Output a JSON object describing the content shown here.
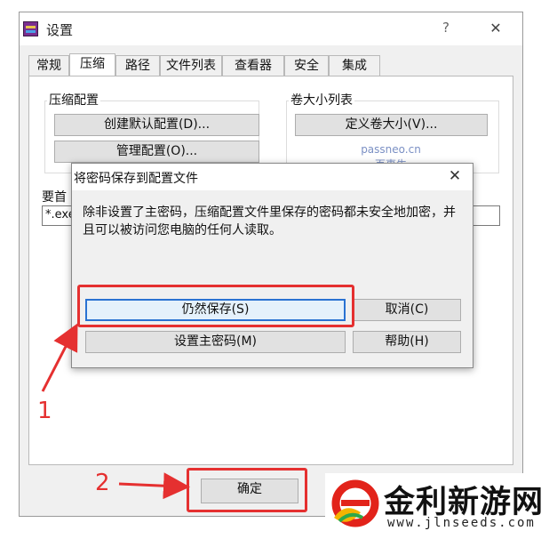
{
  "window": {
    "title": "设置",
    "help_glyph": "?",
    "close_glyph": "✕"
  },
  "tabs": [
    {
      "label": "常规"
    },
    {
      "label": "压缩",
      "active": true
    },
    {
      "label": "路径"
    },
    {
      "label": "文件列表"
    },
    {
      "label": "查看器"
    },
    {
      "label": "安全"
    },
    {
      "label": "集成"
    }
  ],
  "compress_config": {
    "group_label": "压缩配置",
    "create_default_btn": "创建默认配置(D)...",
    "manage_btn": "管理配置(O)..."
  },
  "volume_sizes": {
    "group_label": "卷大小列表",
    "define_btn": "定义卷大小(V)..."
  },
  "watermark": {
    "line1": "passneo.cn",
    "line2": "百事牛"
  },
  "first_files": {
    "label_partial": "要首",
    "input_partial": "*.exe"
  },
  "ok_button": "确定",
  "dialog": {
    "title": "将密码保存到配置文件",
    "close_glyph": "✕",
    "message": "除非设置了主密码，压缩配置文件里保存的密码都未安全地加密，并且可以被访问您电脑的任何人读取。",
    "save_anyway_btn": "仍然保存(S)",
    "cancel_btn": "取消(C)",
    "set_master_btn": "设置主密码(M)",
    "help_btn": "帮助(H)"
  },
  "annotations": {
    "step1": "1",
    "step2": "2"
  },
  "colors": {
    "annotation_red": "#e53030",
    "focus_blue": "#2a72d2"
  },
  "logo": {
    "name": "金利新游网",
    "url": "www.jlnseeds.com"
  }
}
